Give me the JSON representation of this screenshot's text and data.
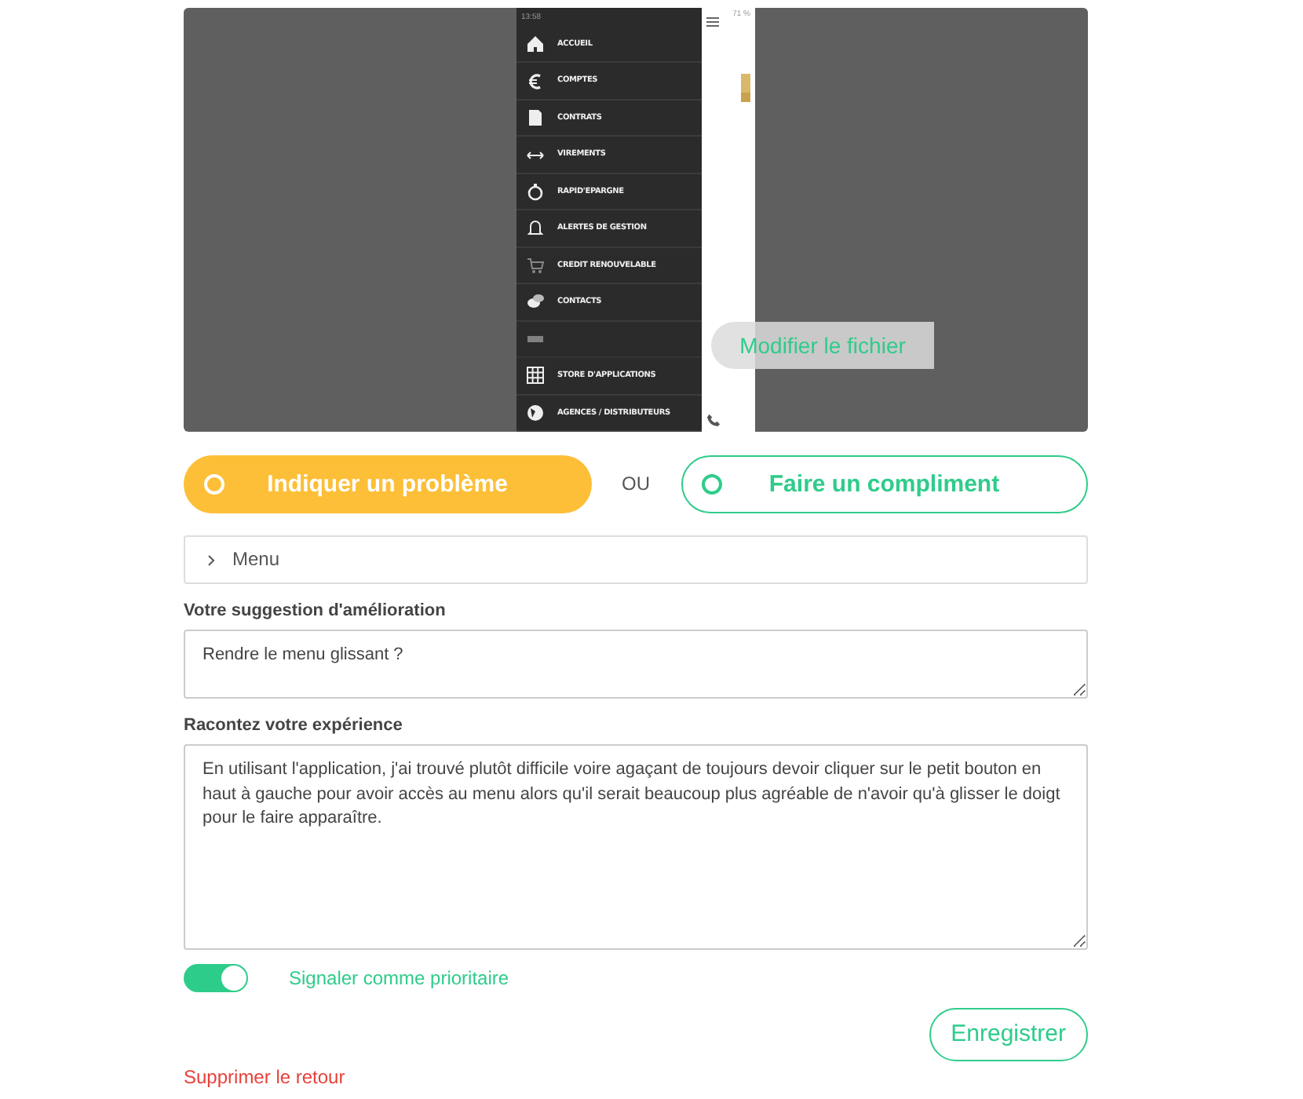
{
  "preview": {
    "phone": {
      "status_bar": {
        "time": "13:58",
        "battery": "71 %"
      },
      "menu": [
        {
          "label": "ACCUEIL"
        },
        {
          "label": "COMPTES"
        },
        {
          "label": "CONTRATS"
        },
        {
          "label": "VIREMENTS"
        },
        {
          "label": "RAPID'EPARGNE"
        },
        {
          "label": "ALERTES DE GESTION"
        },
        {
          "label": "CREDIT RENOUVELABLE"
        },
        {
          "label": "CONTACTS"
        },
        {
          "kind": "covered"
        },
        {
          "label": "STORE D'APPLICATIONS"
        },
        {
          "label": "AGENCES / DISTRIBUTEURS"
        }
      ]
    },
    "overlay_button": "Modifier le fichier"
  },
  "choices": [
    {
      "label": "Indiquer un problème",
      "selected": true
    },
    {
      "label": "Faire un compliment",
      "selected": false
    }
  ],
  "choice_separator": "OU",
  "category": {
    "label": "Menu",
    "expanded": false
  },
  "fields": [
    {
      "label": "Votre suggestion d'amélioration",
      "value": "Rendre le menu glissant ?"
    },
    {
      "label": "Racontez votre expérience",
      "value": "En utilisant l'application, j'ai trouvé plutôt difficile voire agaçant de toujours devoir cliquer sur le petit bouton en haut à gauche pour avoir accès au menu alors qu'il serait beaucoup plus agréable de n'avoir qu'à glisser le doigt pour le faire apparaître."
    }
  ],
  "priority": {
    "label": "Signaler comme prioritaire",
    "on": true
  },
  "save_button": "Enregistrer",
  "delete_link": "Supprimer le retour"
}
